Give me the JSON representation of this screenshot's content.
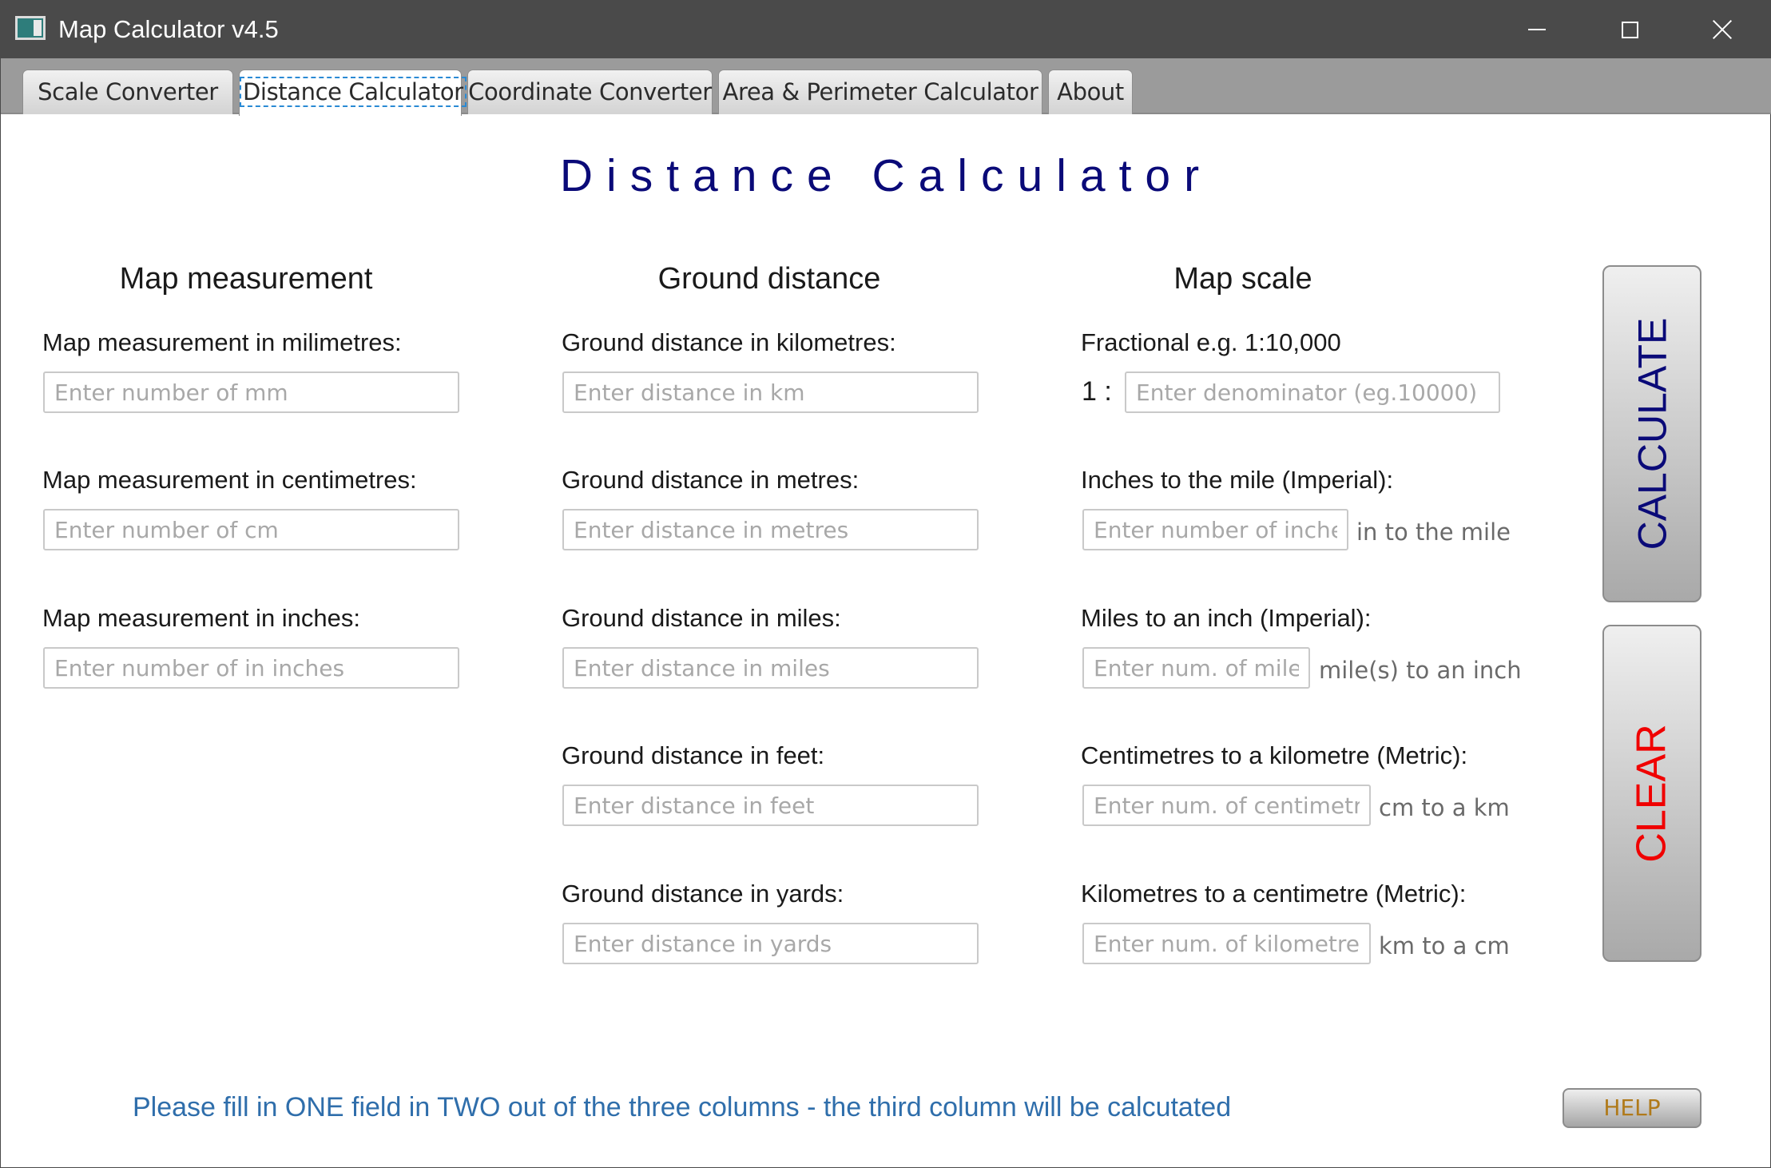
{
  "window": {
    "title": "Map Calculator v4.5",
    "icons": {
      "app": "map-app-icon",
      "minimize": "minimize-icon",
      "maximize": "maximize-icon",
      "close": "close-icon"
    }
  },
  "tabs": [
    {
      "label": "Scale Converter",
      "active": false
    },
    {
      "label": "Distance Calculator",
      "active": true
    },
    {
      "label": "Coordinate Converter",
      "active": false
    },
    {
      "label": "Area & Perimeter  Calculator",
      "active": false
    },
    {
      "label": "About",
      "active": false
    }
  ],
  "main": {
    "heading": "Distance Calculator",
    "instructions": "Please fill in ONE field in TWO out of the three columns - the third column will be calcutated",
    "calculate_label": "CALCULATE",
    "clear_label": "CLEAR",
    "help_label": "HELP"
  },
  "map_measurement": {
    "title": "Map measurement",
    "fields": [
      {
        "label": "Map measurement in milimetres:",
        "value": "",
        "placeholder": "Enter number of mm"
      },
      {
        "label": "Map measurement in centimetres:",
        "value": "",
        "placeholder": "Enter number of cm"
      },
      {
        "label": "Map measurement in inches:",
        "value": "",
        "placeholder": "Enter number of in inches"
      }
    ]
  },
  "ground_distance": {
    "title": "Ground distance",
    "fields": [
      {
        "label": "Ground distance in kilometres:",
        "value": "",
        "placeholder": "Enter distance in km"
      },
      {
        "label": "Ground distance in metres:",
        "value": "",
        "placeholder": "Enter distance in metres"
      },
      {
        "label": "Ground distance in miles:",
        "value": "",
        "placeholder": "Enter distance in miles"
      },
      {
        "label": "Ground distance in feet:",
        "value": "",
        "placeholder": "Enter distance in feet"
      },
      {
        "label": "Ground distance in yards:",
        "value": "",
        "placeholder": "Enter distance in yards"
      }
    ]
  },
  "map_scale": {
    "title": "Map scale",
    "fractional": {
      "label": "Fractional e.g. 1:10,000",
      "prefix": "1 :",
      "value": "",
      "placeholder": "Enter denominator (eg.10000)"
    },
    "fields": [
      {
        "label": "Inches to the mile (Imperial):",
        "value": "",
        "placeholder": "Enter number of inches",
        "suffix": "in to the mile"
      },
      {
        "label": "Miles to an inch (Imperial):",
        "value": "",
        "placeholder": "Enter num. of miles",
        "suffix": "mile(s) to an inch"
      },
      {
        "label": "Centimetres to a kilometre (Metric):",
        "value": "",
        "placeholder": "Enter num. of centimetres",
        "suffix": "cm to a km"
      },
      {
        "label": "Kilometres to a centimetre (Metric):",
        "value": "",
        "placeholder": "Enter num. of kilometres",
        "suffix": "km to a cm"
      }
    ]
  }
}
